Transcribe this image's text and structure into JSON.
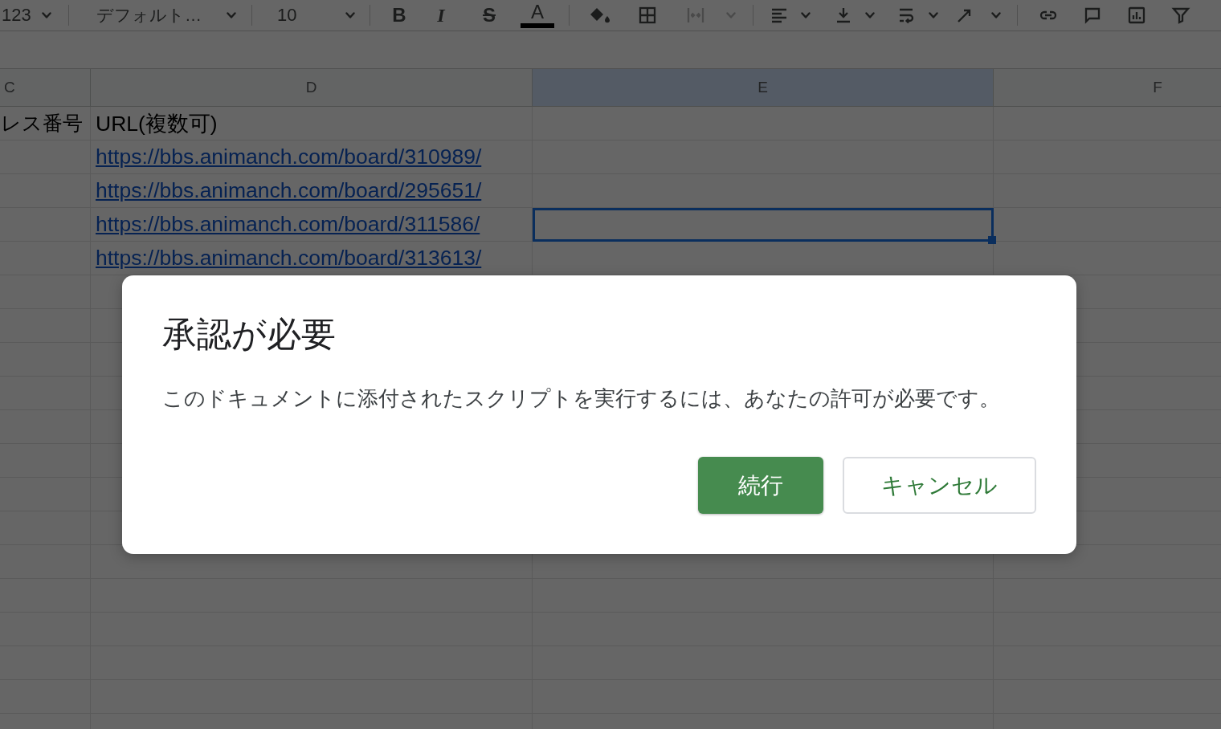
{
  "toolbar": {
    "number_format": "123",
    "font": "デフォルト…",
    "font_size": "10",
    "format_buttons": [
      {
        "kind": "bold",
        "label": "B"
      },
      {
        "kind": "italic",
        "label": "I"
      },
      {
        "kind": "strikethrough",
        "label": "S"
      },
      {
        "kind": "text_color",
        "label": "A"
      }
    ],
    "merge_button": {
      "disabled": true
    }
  },
  "sheet": {
    "columns": [
      {
        "label": "C",
        "selected": false
      },
      {
        "label": "D",
        "selected": false
      },
      {
        "label": "E",
        "selected": true
      },
      {
        "label": "F",
        "selected": false
      }
    ],
    "rows": [
      {
        "cells": [
          {
            "kind": "text",
            "text": "レス番号",
            "selected": false
          },
          {
            "kind": "text",
            "text": "URL(複数可)",
            "selected": false
          },
          {
            "selected": false
          },
          {
            "selected": false
          }
        ]
      },
      {
        "cells": [
          {
            "selected": false
          },
          {
            "kind": "link",
            "text": "https://bbs.animanch.com/board/310989/",
            "selected": false
          },
          {
            "selected": false
          },
          {
            "selected": false
          }
        ]
      },
      {
        "cells": [
          {
            "selected": false
          },
          {
            "kind": "link",
            "text": "https://bbs.animanch.com/board/295651/",
            "selected": false
          },
          {
            "selected": false
          },
          {
            "selected": false
          }
        ]
      },
      {
        "cells": [
          {
            "selected": false
          },
          {
            "kind": "link",
            "text": "https://bbs.animanch.com/board/311586/",
            "selected": false
          },
          {
            "selected": true
          },
          {
            "selected": false
          }
        ]
      },
      {
        "cells": [
          {
            "selected": false
          },
          {
            "kind": "link",
            "text": "https://bbs.animanch.com/board/313613/",
            "selected": false
          },
          {
            "selected": false
          },
          {
            "selected": false
          }
        ]
      }
    ]
  },
  "dialog": {
    "title": "承認が必要",
    "message": "このドキュメントに添付されたスクリプトを実行するには、あなたの許可が必要です。",
    "buttons": [
      {
        "kind": "primary",
        "label": "続行"
      },
      {
        "kind": "secondary",
        "label": "キャンセル"
      }
    ]
  }
}
